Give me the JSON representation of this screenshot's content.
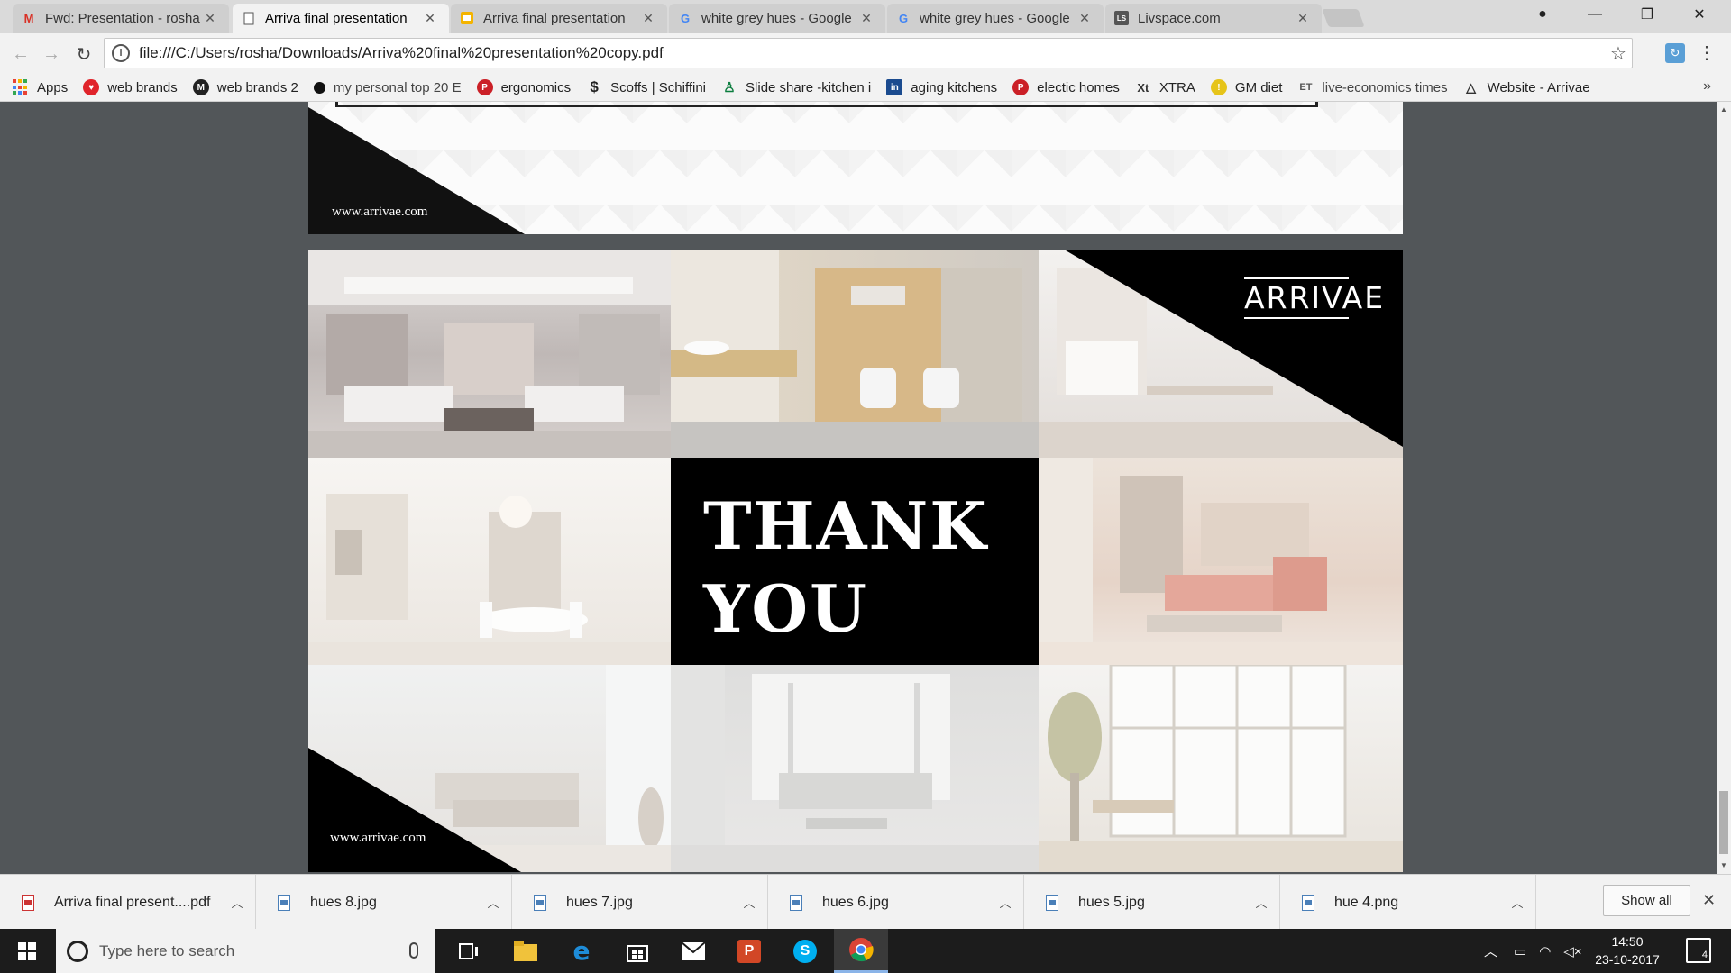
{
  "tabs": [
    {
      "title": "Fwd: Presentation - rosha",
      "icon": "gmail-icon",
      "active": false
    },
    {
      "title": "Arriva final presentation",
      "icon": "document-icon",
      "active": true
    },
    {
      "title": "Arriva final presentation",
      "icon": "slides-icon",
      "active": false
    },
    {
      "title": "white grey hues - Google",
      "icon": "google-icon",
      "active": false
    },
    {
      "title": "white grey hues - Google",
      "icon": "google-icon",
      "active": false
    },
    {
      "title": "Livspace.com",
      "icon": "livspace-icon",
      "active": false
    }
  ],
  "favicon_text": {
    "livspace": "LS",
    "google": "G",
    "gmail": "M"
  },
  "window_controls": {
    "minimize": "—",
    "restore": "❐",
    "close": "✕",
    "profile": "●"
  },
  "nav": {
    "back": "←",
    "forward": "→",
    "reload": "↻"
  },
  "omnibox": {
    "url": "file:///C:/Users/rosha/Downloads/Arriva%20final%20presentation%20copy.pdf",
    "info": "i",
    "star": "☆"
  },
  "bookmarks": [
    {
      "label": "Apps",
      "icon": "apps-icon"
    },
    {
      "label": "web brands",
      "icon": "brand-icon",
      "color": "#e0242b"
    },
    {
      "label": "web brands 2",
      "icon": "brand-icon",
      "color": "#222222"
    },
    {
      "label": "my personal top 20 E",
      "icon": "dot-icon",
      "color": "#111111"
    },
    {
      "label": "ergonomics",
      "icon": "pinterest-icon",
      "color": "#cb2027"
    },
    {
      "label": "Scoffs | Schiffini",
      "icon": "dollar-icon",
      "color": "#222222"
    },
    {
      "label": "Slide share -kitchen i",
      "icon": "slideshare-icon",
      "color": "#0b7d3e"
    },
    {
      "label": "aging kitchens",
      "icon": "linkedin-icon",
      "color": "#1b4b8f"
    },
    {
      "label": "electic homes",
      "icon": "pinterest-icon",
      "color": "#cb2027"
    },
    {
      "label": "XTRA",
      "icon": "xtra-icon",
      "color": "#333333"
    },
    {
      "label": "GM diet",
      "icon": "bulb-icon",
      "color": "#e6c419"
    },
    {
      "label": "live-economics times",
      "icon": "et-icon",
      "color": "#555555"
    },
    {
      "label": "Website - Arrivae",
      "icon": "triangle-icon",
      "color": "#333333"
    }
  ],
  "bookmarks_more": "»",
  "pdf": {
    "page1": {
      "website": "www.arrivae.com"
    },
    "page2": {
      "logo": "ARRIVAE",
      "thank_line1": "THANK",
      "thank_line2": "YOU",
      "website": "www.arrivae.com"
    }
  },
  "downloads": [
    {
      "name": "Arriva final present....pdf",
      "type": "pdf"
    },
    {
      "name": "hues 8.jpg",
      "type": "image"
    },
    {
      "name": "hues 7.jpg",
      "type": "image"
    },
    {
      "name": "hues 6.jpg",
      "type": "image"
    },
    {
      "name": "hues 5.jpg",
      "type": "image"
    },
    {
      "name": "hue 4.png",
      "type": "image"
    }
  ],
  "downloads_show_all": "Show all",
  "downloads_close": "✕",
  "taskbar": {
    "search_placeholder": "Type here to search",
    "time": "14:50",
    "date": "23-10-2017",
    "notification_count": "4",
    "powerpoint_letter": "P",
    "edge_letter": "e",
    "skype_letter": "S"
  }
}
